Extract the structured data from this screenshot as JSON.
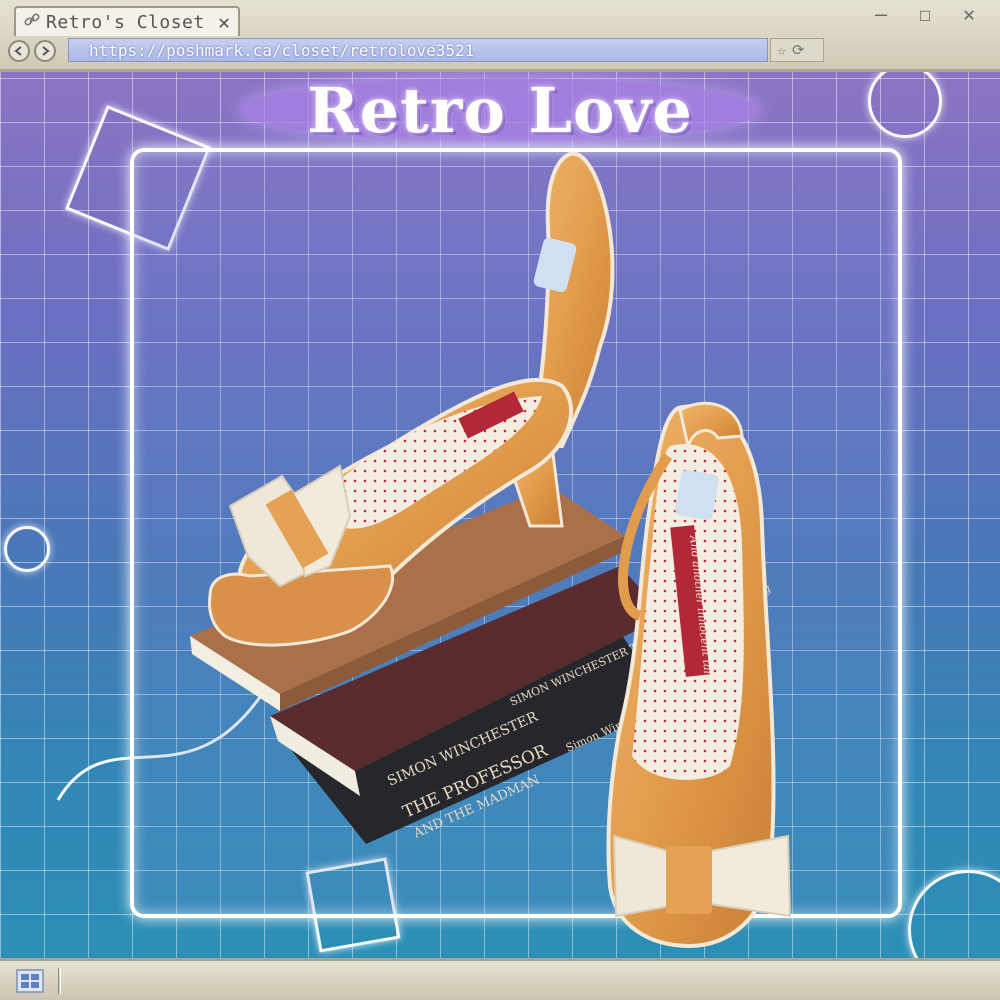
{
  "browser": {
    "tab_title": "Retro's Closet",
    "tab_close": "✕",
    "url": "https://poshmark.ca/closet/retrolove3521",
    "window_controls": {
      "minimize": "—",
      "maximize": "☐",
      "close": "✕"
    },
    "icons": {
      "back": "arrow-left-icon",
      "forward": "arrow-right-icon",
      "bookmark": "star-icon",
      "reload": "reload-icon"
    }
  },
  "page": {
    "logo": "Retro Love",
    "product_labels": {
      "insole_script": "And another innocent tale...",
      "book_author_1": "SIMON WINCHESTER",
      "book_title_1": "THE PROFESSOR",
      "book_title_1b": "AND THE MADMAN",
      "book_author_2": "Simon Winchester",
      "book_spine_2": "SIMON WINCHESTER  The Meaning of Everything"
    },
    "colors": {
      "shoe": "#e5a255",
      "bow": "#efe8d8",
      "insole_dots": "#c22c3c",
      "background_top": "#8d74c4",
      "background_bottom": "#2c8fb6"
    }
  },
  "taskbar": {
    "start_icon": "windows-logo-icon"
  }
}
